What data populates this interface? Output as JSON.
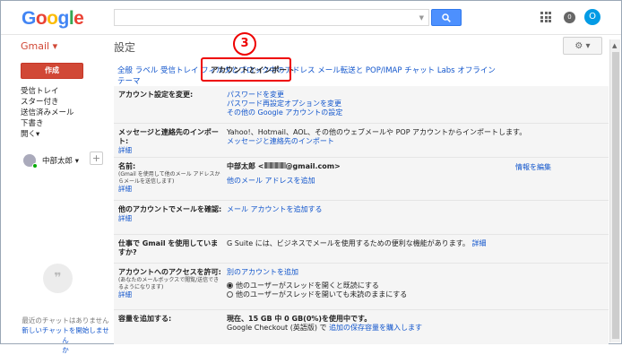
{
  "header": {
    "logo": "Google",
    "avatar": "O",
    "bell": "0"
  },
  "app": {
    "name": "Gmail ▾",
    "title": "設定",
    "gear": "⚙ ▾",
    "compose": "作成"
  },
  "nav": {
    "items": [
      "受信トレイ",
      "スター付き",
      "送信済みメール",
      "下書き",
      "開く▾"
    ]
  },
  "user": {
    "name": "中部太郎 ▾"
  },
  "chat": {
    "no_recent": "最近のチャットはありません",
    "start": "新しいチャットを開始しません",
    "start2": "か"
  },
  "tabs": [
    "全般",
    "ラベル",
    "受信トレイ",
    "アカウントとインポート",
    "フィルタとブロック中のアドレス",
    "メール転送と POP/IMAP",
    "チャット",
    "Labs",
    "オフライン",
    "テーマ"
  ],
  "callout": "3",
  "settings": {
    "change": {
      "label": "アカウント設定を変更:",
      "links": [
        "パスワードを変更",
        "パスワード再設定オプションを変更",
        "その他の Google アカウントの設定"
      ]
    },
    "import": {
      "label": "メッセージと連絡先のインポート:",
      "more": "詳細",
      "text": "Yahoo!、Hotmail、AOL、その他のウェブメールや POP アカウントからインポートします。",
      "link": "メッセージと連絡先のインポート"
    },
    "name": {
      "label": "名前:",
      "note": "(Gmail を使用して他のメール アドレスからメールを送信します)",
      "more": "詳細",
      "user": "中部太郎 <",
      "email": "@gmail.com>",
      "edit": "情報を編集",
      "add": "他のメール アドレスを追加"
    },
    "check": {
      "label": "他のアカウントでメールを確認:",
      "more": "詳細",
      "link": "メール アカウントを追加する"
    },
    "work": {
      "label": "仕事で Gmail を使用していますか?",
      "text": "G Suite には、ビジネスでメールを使用するための便利な機能があります。",
      "more": "詳細"
    },
    "grant": {
      "label": "アカウントへのアクセスを許可:",
      "note": "(あなたのメールボックスで閲覧/送信できるようになります)",
      "more": "詳細",
      "link": "別のアカウントを追加",
      "opt1": "他のユーザーがスレッドを開くと既読にする",
      "opt2": "他のユーザーがスレッドを開いても未読のままにする"
    },
    "storage": {
      "label": "容量を追加する:",
      "text": "現在、15 GB 中 0 GB(0%)を使用中です。",
      "text2a": "Google Checkout (英語版) で",
      "link": "追加の保存容量を購入します"
    }
  }
}
